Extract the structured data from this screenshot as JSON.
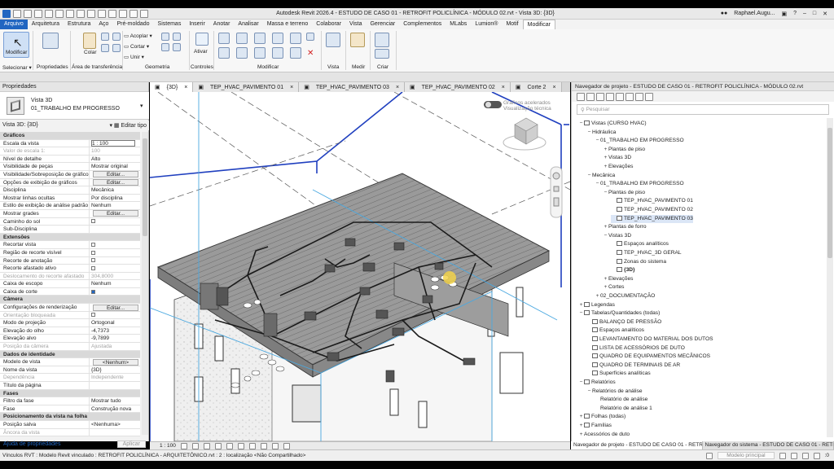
{
  "titlebar": {
    "title": "Autodesk Revit 2026.4 - ESTUDO DE CASO 01 - RETROFIT POLICLÍNICA - MÓDULO 02.rvt - Vista 3D: {3D}",
    "user": "Raphael.Augu..."
  },
  "menu": [
    "Arquivo",
    "Arquitetura",
    "Estrutura",
    "Aço",
    "Pré-moldado",
    "Sistemas",
    "Inserir",
    "Anotar",
    "Analisar",
    "Massa e terreno",
    "Colaborar",
    "Vista",
    "Gerenciar",
    "Complementos",
    "MLabs",
    "Lumion®",
    "Motif",
    "Modificar"
  ],
  "ribbon": {
    "modify": "Modificar",
    "paste": "Colar",
    "activate": "Ativar",
    "clip_items": [
      "Acoplar",
      "Cortar",
      "Unir"
    ],
    "panels": [
      "Selecionar",
      "Propriedades",
      "Área de transferência",
      "Geometria",
      "Controles",
      "Modificar",
      "Vista",
      "Medir",
      "Criar"
    ]
  },
  "properties": {
    "title": "Propriedades",
    "type_line1": "Vista 3D",
    "type_line2": "01_TRABALHO EM PROGRESSO",
    "view_selector": "Vista 3D: {3D}",
    "edit_type": "Editar tipo",
    "apply": "Aplicar",
    "help": "Ajuda de propriedades",
    "rows": [
      {
        "k": "Gráficos",
        "v": "",
        "t": "sec"
      },
      {
        "k": "Escala da vista",
        "v": "1 : 100",
        "t": "inp"
      },
      {
        "k": "Valor de escala    1:",
        "v": "100",
        "t": "dim"
      },
      {
        "k": "Nível de detalhe",
        "v": "Alto",
        "t": ""
      },
      {
        "k": "Visibilidade de peças",
        "v": "Mostrar original",
        "t": ""
      },
      {
        "k": "Visibilidade/Sobreposição de gráficos",
        "v": "Editar...",
        "t": "btn"
      },
      {
        "k": "Opções de exibição de gráficos",
        "v": "Editar...",
        "t": "btn"
      },
      {
        "k": "Disciplina",
        "v": "Mecânica",
        "t": ""
      },
      {
        "k": "Mostrar linhas ocultas",
        "v": "Por disciplina",
        "t": ""
      },
      {
        "k": "Estilo de exibição de análise padrão",
        "v": "Nenhum",
        "t": ""
      },
      {
        "k": "Mostrar grades",
        "v": "Editar...",
        "t": "btn"
      },
      {
        "k": "Caminho do sol",
        "v": "",
        "t": "cb"
      },
      {
        "k": "Sub-Disciplina",
        "v": "",
        "t": ""
      },
      {
        "k": "Extensões",
        "v": "",
        "t": "sec"
      },
      {
        "k": "Recortar vista",
        "v": "",
        "t": "cb"
      },
      {
        "k": "Região de recorte visível",
        "v": "",
        "t": "cb"
      },
      {
        "k": "Recorte de anotação",
        "v": "",
        "t": "cb"
      },
      {
        "k": "Recorte afastado ativo",
        "v": "",
        "t": "cb"
      },
      {
        "k": "Deslocamento do recorte afastado",
        "v": "304,8000",
        "t": "dim"
      },
      {
        "k": "Caixa de escopo",
        "v": "Nenhum",
        "t": ""
      },
      {
        "k": "Caixa de corte",
        "v": "",
        "t": "cbon"
      },
      {
        "k": "Câmera",
        "v": "",
        "t": "sec"
      },
      {
        "k": "Configurações de renderização",
        "v": "Editar...",
        "t": "btn"
      },
      {
        "k": "Orientação bloqueada",
        "v": "",
        "t": "dimcb"
      },
      {
        "k": "Modo de projeção",
        "v": "Ortogonal",
        "t": ""
      },
      {
        "k": "Elevação do olho",
        "v": "-4,7373",
        "t": ""
      },
      {
        "k": "Elevação alvo",
        "v": "-9,7899",
        "t": ""
      },
      {
        "k": "Posição da câmera",
        "v": "Ajustada",
        "t": "dim"
      },
      {
        "k": "Dados de identidade",
        "v": "",
        "t": "sec"
      },
      {
        "k": "Modelo de vista",
        "v": "<Nenhum>",
        "t": "btn"
      },
      {
        "k": "Nome da vista",
        "v": "{3D}",
        "t": ""
      },
      {
        "k": "Dependência",
        "v": "Independente",
        "t": "dim"
      },
      {
        "k": "Título da página",
        "v": "",
        "t": ""
      },
      {
        "k": "Fases",
        "v": "",
        "t": "sec"
      },
      {
        "k": "Filtro da fase",
        "v": "Mostrar tudo",
        "t": ""
      },
      {
        "k": "Fase",
        "v": "Construção nova",
        "t": ""
      },
      {
        "k": "Posicionamento da vista na folha",
        "v": "",
        "t": "sec"
      },
      {
        "k": "Posição salva",
        "v": "<Nenhuma>",
        "t": ""
      },
      {
        "k": "Âncora da vista",
        "v": "",
        "t": "dim"
      }
    ]
  },
  "view_tabs": [
    {
      "label": "{3D}",
      "active": true
    },
    {
      "label": "TEP_HVAC_PAVIMENTO 01",
      "active": false
    },
    {
      "label": "TEP_HVAC_PAVIMENTO 03",
      "active": false
    },
    {
      "label": "TEP_HVAC_PAVIMENTO 02",
      "active": false
    },
    {
      "label": "Corte 2",
      "active": false
    }
  ],
  "viewport": {
    "graphics_line1": "Gráficos acelerados",
    "graphics_line2": "Visualização técnica"
  },
  "view_control": {
    "scale": "1 : 100"
  },
  "browser": {
    "title": "Navegador de projeto - ESTUDO DE CASO 01 - RETROFIT POLICLÍNICA - MÓDULO 02.rvt",
    "search_placeholder": "Pesquisar",
    "nodes": [
      {
        "d": 0,
        "g": "−",
        "i": true,
        "label": "Vistas (CURSO HVAC)"
      },
      {
        "d": 1,
        "g": "−",
        "i": false,
        "label": "Hidráulica"
      },
      {
        "d": 2,
        "g": "−",
        "i": false,
        "label": "01_TRABALHO EM PROGRESSO"
      },
      {
        "d": 3,
        "g": "+",
        "i": false,
        "label": "Plantas de piso"
      },
      {
        "d": 3,
        "g": "+",
        "i": false,
        "label": "Vistas 3D"
      },
      {
        "d": 3,
        "g": "+",
        "i": false,
        "label": "Elevações"
      },
      {
        "d": 1,
        "g": "−",
        "i": false,
        "label": "Mecânica"
      },
      {
        "d": 2,
        "g": "−",
        "i": false,
        "label": "01_TRABALHO EM PROGRESSO"
      },
      {
        "d": 3,
        "g": "−",
        "i": false,
        "label": "Plantas de piso"
      },
      {
        "d": 4,
        "g": "",
        "i": true,
        "label": "TEP_HVAC_PAVIMENTO 01"
      },
      {
        "d": 4,
        "g": "",
        "i": true,
        "label": "TEP_HVAC_PAVIMENTO 02"
      },
      {
        "d": 4,
        "g": "",
        "i": true,
        "label": "TEP_HVAC_PAVIMENTO 03",
        "sel": true
      },
      {
        "d": 3,
        "g": "+",
        "i": false,
        "label": "Plantas de forro"
      },
      {
        "d": 3,
        "g": "−",
        "i": false,
        "label": "Vistas 3D"
      },
      {
        "d": 4,
        "g": "",
        "i": true,
        "label": "Espaços analíticos"
      },
      {
        "d": 4,
        "g": "",
        "i": true,
        "label": "TEP_HVAC_3D GERAL"
      },
      {
        "d": 4,
        "g": "",
        "i": true,
        "label": "Zonas do sistema"
      },
      {
        "d": 4,
        "g": "",
        "i": true,
        "label": "{3D}",
        "bold": true
      },
      {
        "d": 3,
        "g": "+",
        "i": false,
        "label": "Elevações"
      },
      {
        "d": 3,
        "g": "+",
        "i": false,
        "label": "Cortes"
      },
      {
        "d": 2,
        "g": "+",
        "i": false,
        "label": "02_DOCUMENTAÇÃO"
      },
      {
        "d": 0,
        "g": "+",
        "i": true,
        "label": "Legendas"
      },
      {
        "d": 0,
        "g": "−",
        "i": true,
        "label": "Tabelas/Quantidades (todas)"
      },
      {
        "d": 1,
        "g": "",
        "i": true,
        "label": "BALANÇO DE PRESSÃO"
      },
      {
        "d": 1,
        "g": "",
        "i": true,
        "label": "Espaços analíticos"
      },
      {
        "d": 1,
        "g": "",
        "i": true,
        "label": "LEVANTAMENTO DO MATERIAL DOS DUTOS"
      },
      {
        "d": 1,
        "g": "",
        "i": true,
        "label": "LISTA DE ACESSÓRIOS DE DUTO"
      },
      {
        "d": 1,
        "g": "",
        "i": true,
        "label": "QUADRO DE EQUIPAMENTOS MECÂNICOS"
      },
      {
        "d": 1,
        "g": "",
        "i": true,
        "label": "QUADRO DE TERMINAIS DE AR"
      },
      {
        "d": 1,
        "g": "",
        "i": true,
        "label": "Superfícies analíticas"
      },
      {
        "d": 0,
        "g": "−",
        "i": true,
        "label": "Relatórios"
      },
      {
        "d": 1,
        "g": "−",
        "i": false,
        "label": "Relatórios de análise"
      },
      {
        "d": 2,
        "g": "",
        "i": false,
        "label": "Relatório de análise"
      },
      {
        "d": 2,
        "g": "",
        "i": false,
        "label": "Relatório de análise 1"
      },
      {
        "d": 0,
        "g": "+",
        "i": true,
        "label": "Folhas (todas)"
      },
      {
        "d": 0,
        "g": "+",
        "i": true,
        "label": "Famílias"
      },
      {
        "d": 0,
        "g": "+",
        "i": false,
        "label": "Acessórios de duto"
      }
    ],
    "bottom_tabs": [
      "Navegador de projeto - ESTUDO DE CASO 01 - RETR...",
      "Navegador do sistema - ESTUDO DE CASO 01 - RETR..."
    ]
  },
  "status": {
    "text": "Vínculos RVT : Modelo Revit vinculado : RETROFIT POLICLÍNICA - ARQUITETÔNICO.rvt : 2 : localização <Não Compartilhado>",
    "model": "Modelo principal",
    "count": ":0"
  },
  "colors": {
    "accent": "#2166c1",
    "crop_box": "#1f3fbf",
    "section_line": "#4aa8e0"
  }
}
